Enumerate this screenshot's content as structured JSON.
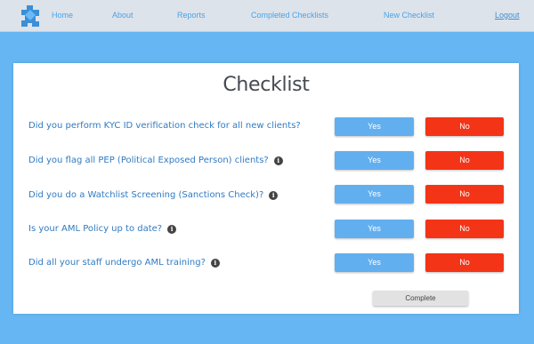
{
  "nav": {
    "logo_icon": "puzzle-logo-icon",
    "home": "Home",
    "about": "About",
    "reports": "Reports",
    "completed": "Completed Checklists",
    "new_checklist": "New Checklist",
    "logout": "Logout"
  },
  "page": {
    "title": "Checklist"
  },
  "questions": [
    {
      "text": "Did you perform KYC ID verification check for all new clients?",
      "info": false,
      "yes": "Yes",
      "no": "No"
    },
    {
      "text": "Did you flag all PEP (Political Exposed Person) clients?",
      "info": true,
      "yes": "Yes",
      "no": "No"
    },
    {
      "text": "Did you do a Watchlist Screening (Sanctions Check)?",
      "info": true,
      "yes": "Yes",
      "no": "No"
    },
    {
      "text": "Is your AML Policy up to date?",
      "info": true,
      "yes": "Yes",
      "no": "No"
    },
    {
      "text": "Did all your staff undergo AML training?",
      "info": true,
      "yes": "Yes",
      "no": "No"
    }
  ],
  "complete_label": "Complete",
  "colors": {
    "background": "#65b6f3",
    "yes_button": "#62aff0",
    "no_button": "#f43417",
    "question_text": "#2f7bc2"
  }
}
